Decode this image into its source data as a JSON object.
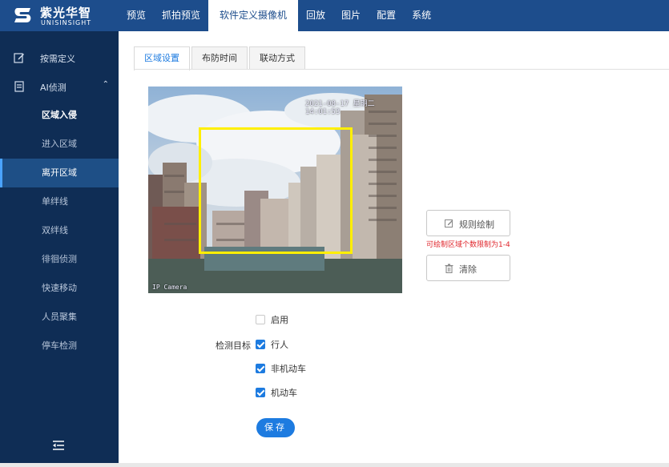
{
  "brand": {
    "name_cn": "紫光华智",
    "name_en": "UNISINSIGHT"
  },
  "nav": {
    "items": [
      {
        "label": "预览"
      },
      {
        "label": "抓拍预览"
      },
      {
        "label": "软件定义摄像机",
        "active": true
      },
      {
        "label": "回放"
      },
      {
        "label": "图片"
      },
      {
        "label": "配置"
      },
      {
        "label": "系统"
      }
    ]
  },
  "sidebar": {
    "groups": [
      {
        "label": "按需定义",
        "icon": "edit-icon"
      },
      {
        "label": "AI侦测",
        "icon": "document-icon",
        "expanded": true
      }
    ],
    "items": [
      {
        "label": "区域入侵",
        "state": "current"
      },
      {
        "label": "进入区域"
      },
      {
        "label": "离开区域",
        "state": "active"
      },
      {
        "label": "单绊线"
      },
      {
        "label": "双绊线"
      },
      {
        "label": "徘徊侦测"
      },
      {
        "label": "快速移动"
      },
      {
        "label": "人员聚集"
      },
      {
        "label": "停车检测"
      }
    ],
    "collapse_icon": "collapse-menu-icon"
  },
  "tabs": [
    {
      "label": "区域设置",
      "active": true
    },
    {
      "label": "布防时间"
    },
    {
      "label": "联动方式"
    }
  ],
  "video": {
    "osd_time": "2021-08-17 星期二 14:01:53",
    "osd_name": "IP Camera",
    "roi_color": "#ffef00"
  },
  "actions": {
    "draw_label": "规则绘制",
    "draw_icon": "pencil-icon",
    "hint": "可绘制区域个数限制为1-4",
    "clear_label": "清除",
    "clear_icon": "trash-icon"
  },
  "form": {
    "enable_label": "启用",
    "enable_checked": false,
    "target_label": "检测目标",
    "targets": [
      {
        "label": "行人",
        "checked": true
      },
      {
        "label": "非机动车",
        "checked": true
      },
      {
        "label": "机动车",
        "checked": true
      }
    ],
    "save_label": "保存"
  },
  "colors": {
    "topbar": "#1d4d8c",
    "sidebar": "#0f2d55",
    "accent": "#1d7be0",
    "hint": "#e0262c"
  }
}
